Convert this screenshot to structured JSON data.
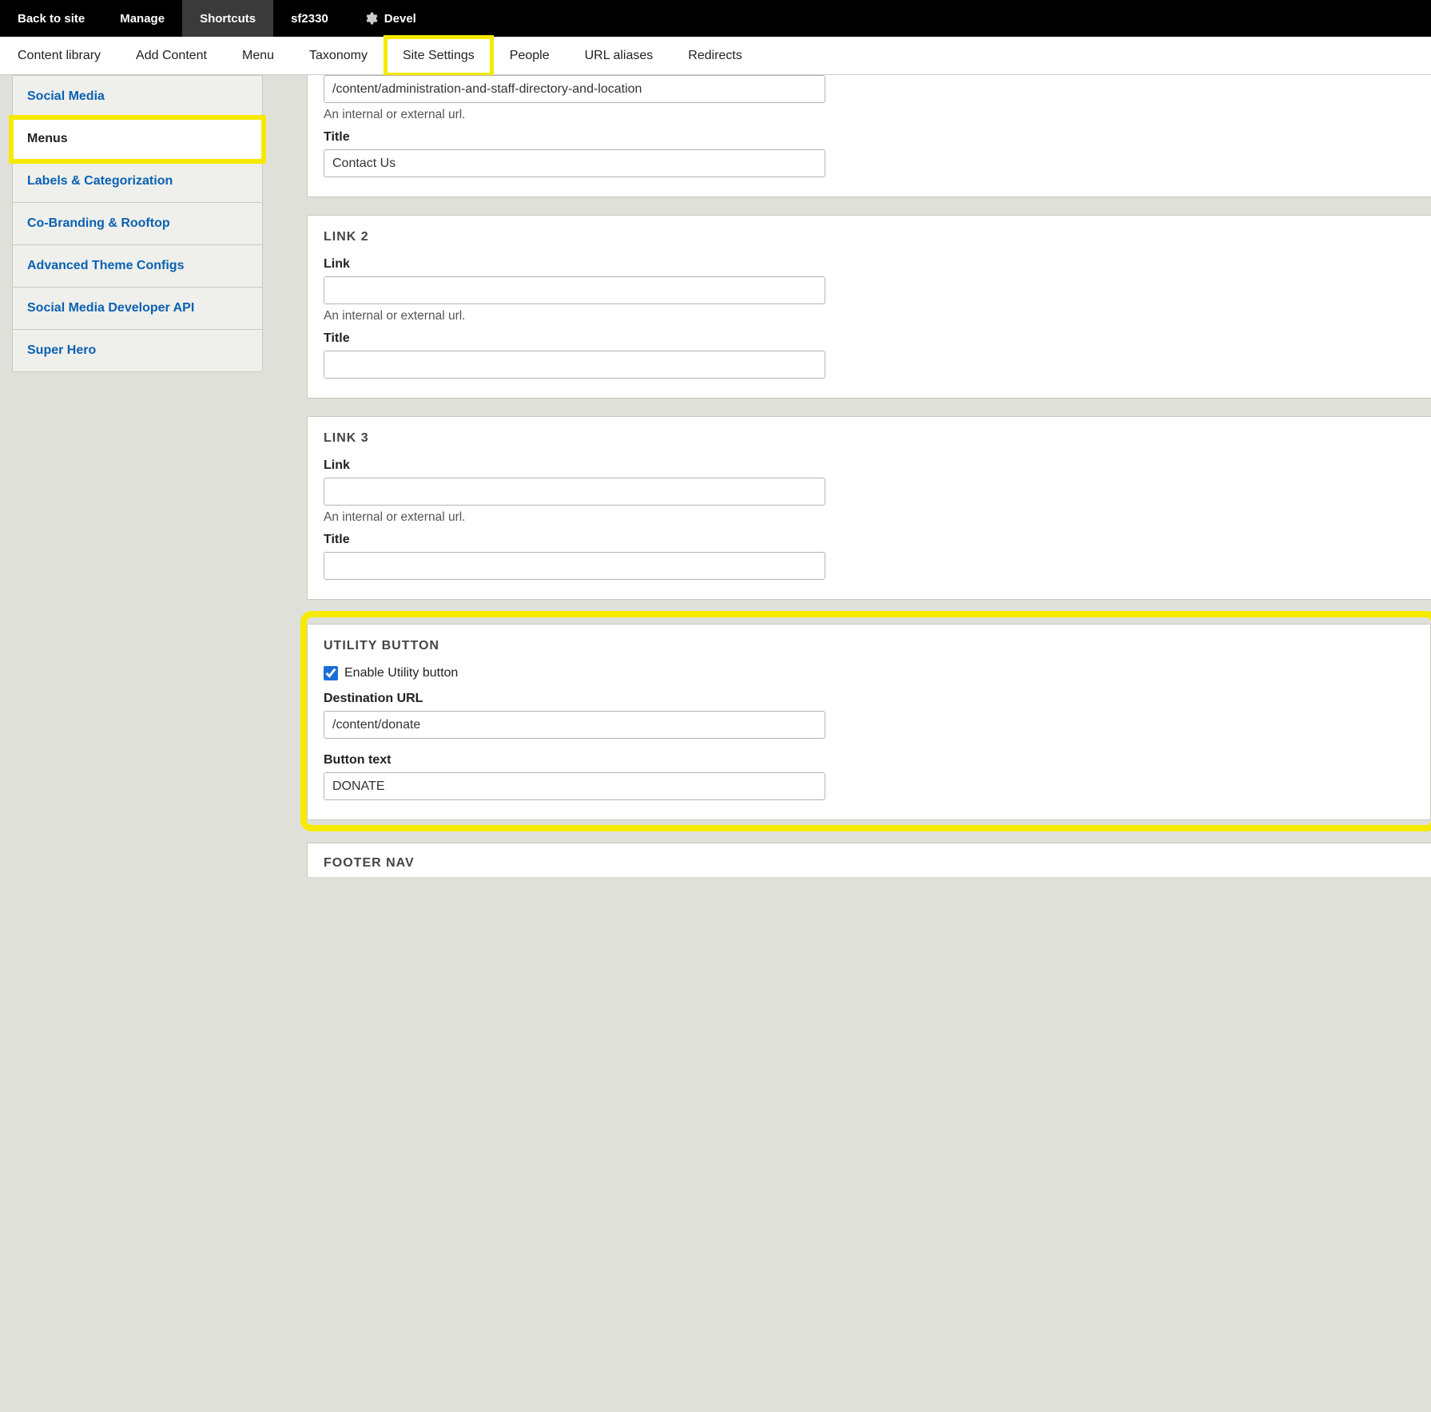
{
  "topbar": {
    "back": "Back to site",
    "manage": "Manage",
    "shortcuts": "Shortcuts",
    "site_id": "sf2330",
    "devel": "Devel"
  },
  "nav": {
    "content_library": "Content library",
    "add_content": "Add Content",
    "menu": "Menu",
    "taxonomy": "Taxonomy",
    "site_settings": "Site Settings",
    "people": "People",
    "url_aliases": "URL aliases",
    "redirects": "Redirects"
  },
  "sidebar": {
    "social_media": "Social Media",
    "menus": "Menus",
    "labels": "Labels & Categorization",
    "cobranding": "Co-Branding & Rooftop",
    "advanced": "Advanced Theme Configs",
    "dev_api": "Social Media Developer API",
    "super_hero": "Super Hero"
  },
  "link1": {
    "link_label": "Link",
    "link_value": "/content/administration-and-staff-directory-and-location",
    "link_help": "An internal or external url.",
    "title_label": "Title",
    "title_value": "Contact Us"
  },
  "link2": {
    "panel_title": "LINK 2",
    "link_label": "Link",
    "link_value": "",
    "link_help": "An internal or external url.",
    "title_label": "Title",
    "title_value": ""
  },
  "link3": {
    "panel_title": "LINK 3",
    "link_label": "Link",
    "link_value": "",
    "link_help": "An internal or external url.",
    "title_label": "Title",
    "title_value": ""
  },
  "utility": {
    "panel_title": "UTILITY BUTTON",
    "checkbox_label": "Enable Utility button",
    "checkbox_checked": true,
    "dest_label": "Destination URL",
    "dest_value": "/content/donate",
    "btn_label": "Button text",
    "btn_value": "DONATE"
  },
  "footer": {
    "panel_title": "FOOTER NAV"
  }
}
